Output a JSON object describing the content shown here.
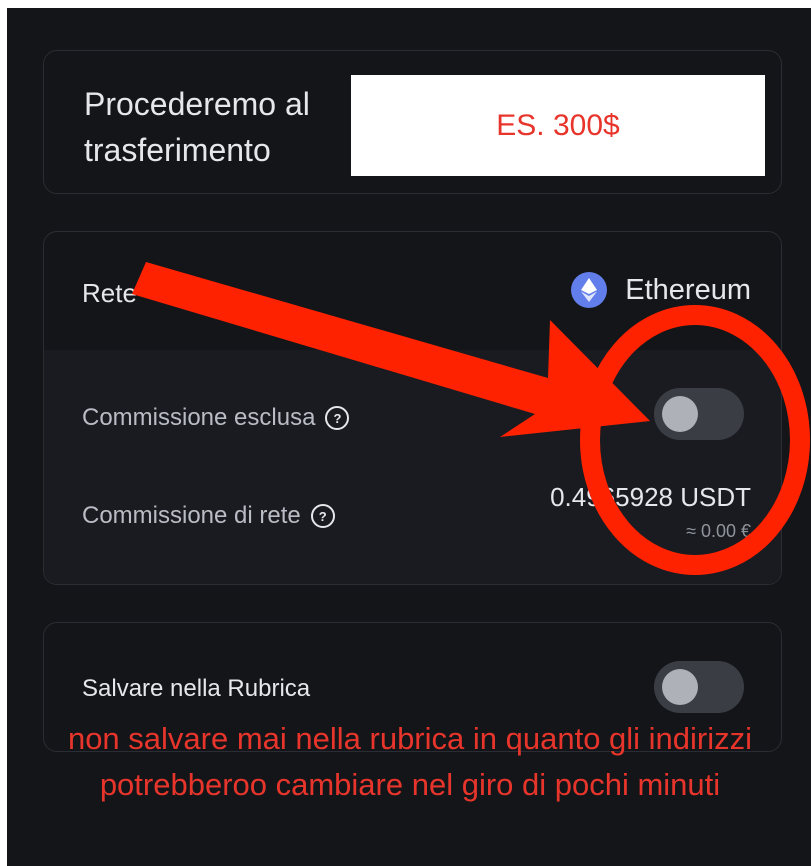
{
  "transfer": {
    "label": "Procederemo al trasferimento",
    "amount": "ES. 300$"
  },
  "network": {
    "label": "Rete",
    "value": "Ethereum",
    "icon": "ethereum-icon"
  },
  "fees": {
    "excluded_label": "Commissione esclusa",
    "excluded_toggle_on": false,
    "network_fee_label": "Commissione di rete",
    "network_fee_value": "0.4965928 USDT",
    "network_fee_sub": "≈ 0.00 €"
  },
  "address_book": {
    "save_label": "Salvare nella Rubrica",
    "save_toggle_on": false
  },
  "annotation": {
    "warning": "non salvare mai nella rubrica in quanto gli indirizzi potrebberoo cambiare nel giro di pochi minuti",
    "color": "#ff2200"
  }
}
